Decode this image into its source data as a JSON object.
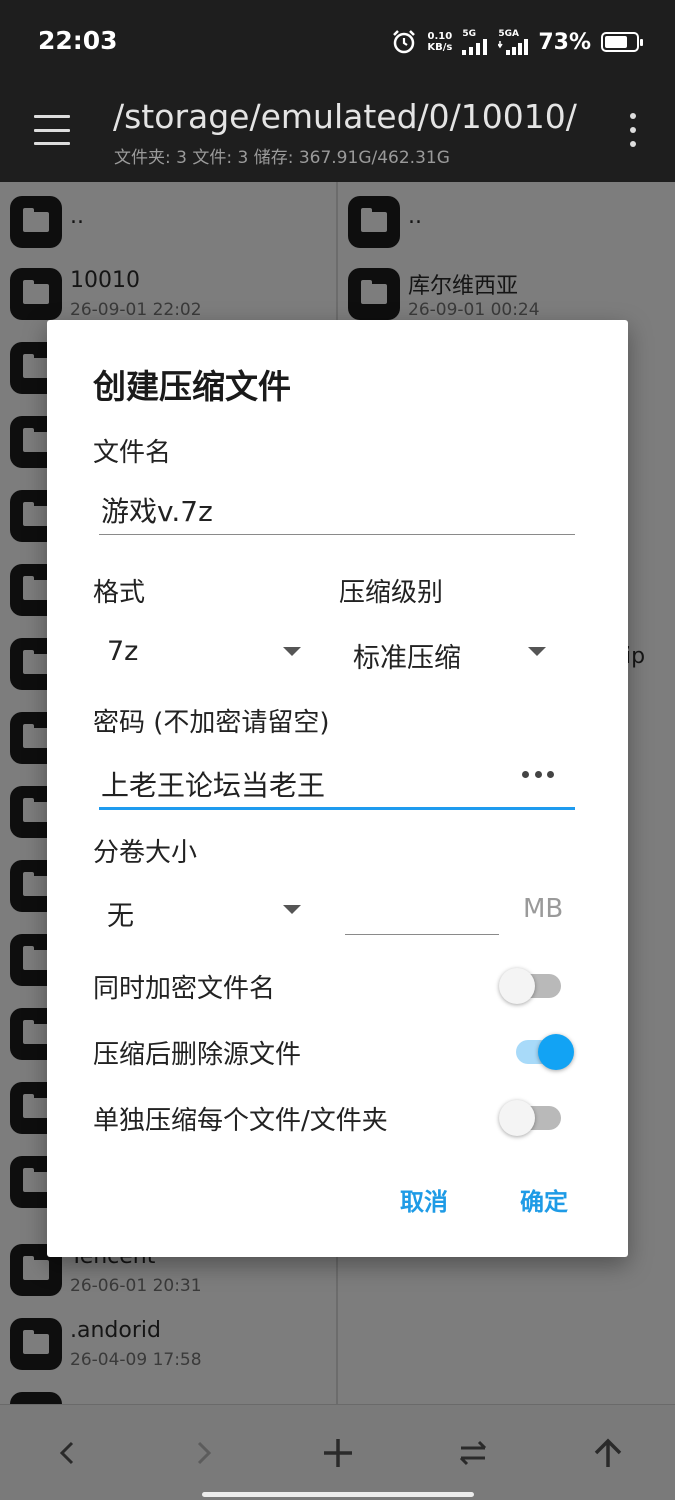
{
  "status_bar": {
    "time": "22:03",
    "net_speed_value": "0.10",
    "net_speed_unit": "KB/s",
    "sim1_label": "5G",
    "sim2_label": "5GA",
    "battery_percent": "73%",
    "battery_level": 0.73
  },
  "app_bar": {
    "path": "/storage/emulated/0/10010/",
    "summary": "文件夹: 3  文件: 3  储存: 367.91G/462.31G"
  },
  "left_pane": {
    "items": [
      {
        "name": "..",
        "date": ""
      },
      {
        "name": "10010",
        "date": "26-09-01 22:02"
      },
      {
        "name": "Tencent",
        "date": "26-06-01 20:31"
      },
      {
        "name": ".andorid",
        "date": "26-04-09 17:58"
      }
    ]
  },
  "right_pane": {
    "items": [
      {
        "name": "..",
        "date": ""
      },
      {
        "name": "库尔维西亚",
        "date": "26-09-01 00:24"
      }
    ],
    "partial_text": "ip"
  },
  "dialog": {
    "title": "创建压缩文件",
    "filename_label": "文件名",
    "filename_value": "游戏v.7z",
    "format_label": "格式",
    "format_value": "7z",
    "level_label": "压缩级别",
    "level_value": "标准压缩",
    "password_label": "密码 (不加密请留空)",
    "password_value": "上老王论坛当老王",
    "volume_label": "分卷大小",
    "volume_value": "无",
    "volume_size_value": "",
    "volume_unit": "MB",
    "options": [
      {
        "label": "同时加密文件名",
        "on": false
      },
      {
        "label": "压缩后删除源文件",
        "on": true
      },
      {
        "label": "单独压缩每个文件/文件夹",
        "on": false
      }
    ],
    "cancel_label": "取消",
    "ok_label": "确定"
  },
  "colors": {
    "accent": "#1e9bef",
    "switch_on": "#12a3f4",
    "app_bar": "#1e1e1e"
  },
  "icons": {
    "menu": "hamburger-menu-icon",
    "more": "more-vert-icon",
    "back": "chevron-left-icon",
    "forward": "chevron-right-icon",
    "add": "plus-icon",
    "swap": "swap-icon",
    "up": "arrow-up-icon",
    "folder": "folder-icon",
    "password_toggle": "dots-icon"
  }
}
